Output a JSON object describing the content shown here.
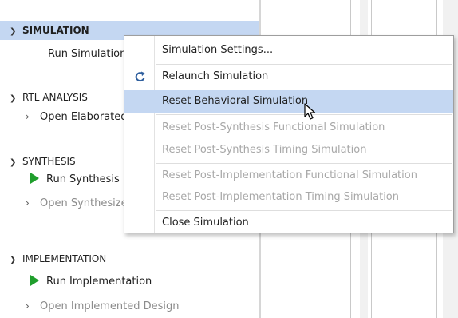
{
  "flow_navigator": {
    "simulation": {
      "header": "SIMULATION",
      "items": [
        "Run Simulation"
      ]
    },
    "rtl_analysis": {
      "header": "RTL ANALYSIS",
      "items": [
        "Open Elaborated Design"
      ]
    },
    "synthesis": {
      "header": "SYNTHESIS",
      "items": [
        "Run Synthesis",
        "Open Synthesized Design"
      ]
    },
    "implementation": {
      "header": "IMPLEMENTATION",
      "items": [
        "Run Implementation",
        "Open Implemented Design"
      ]
    }
  },
  "context_menu": {
    "items": [
      {
        "label": "Simulation Settings...",
        "enabled": true
      },
      {
        "label": "Relaunch Simulation",
        "enabled": true,
        "icon": "refresh-icon"
      },
      {
        "label": "Reset Behavioral Simulation",
        "enabled": true,
        "highlighted": true
      },
      {
        "label": "Reset Post-Synthesis Functional Simulation",
        "enabled": false
      },
      {
        "label": "Reset Post-Synthesis Timing Simulation",
        "enabled": false
      },
      {
        "label": "Reset Post-Implementation Functional Simulation",
        "enabled": false
      },
      {
        "label": "Reset Post-Implementation Timing Simulation",
        "enabled": false
      },
      {
        "label": "Close Simulation",
        "enabled": true
      }
    ]
  },
  "colors": {
    "selection": "#c4d7f2",
    "run_icon": "#1f9e2c",
    "refresh_icon": "#2f5f9e"
  }
}
